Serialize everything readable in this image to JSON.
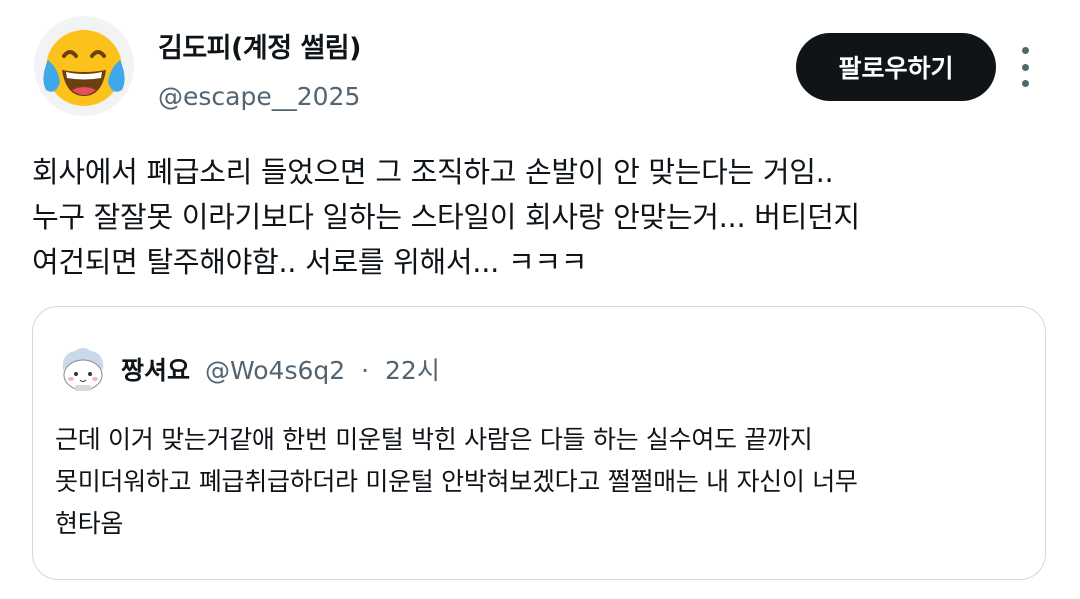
{
  "author": {
    "display_name": "김도피(계정 썰림)",
    "handle": "@escape__2025",
    "avatar_icon": "face-with-tears-of-joy-emoji"
  },
  "actions": {
    "follow_label": "팔로우하기",
    "more_icon": "more-vertical-icon"
  },
  "tweet": {
    "lines": [
      "회사에서 폐급소리 들었으면 그 조직하고 손발이 안 맞는다는 거임..",
      "누구 잘잘못 이라기보다 일하는 스타일이 회사랑 안맞는거... 버티던지",
      "여건되면 탈주해야함.. 서로를 위해서... ㅋㅋㅋ"
    ]
  },
  "quote": {
    "display_name": "짱셔요",
    "handle": "@Wo4s6q2",
    "separator": "·",
    "time": "22시",
    "avatar_icon": "cartoon-character-avatar",
    "lines": [
      "근데 이거 맞는거같애 한번 미운털 박힌 사람은 다들 하는 실수여도 끝까지",
      "못미더워하고 폐급취급하더라 미운털 안박혀보겠다고 쩔쩔매는 내 자신이 너무",
      "현타옴"
    ]
  },
  "colors": {
    "text": "#0f1419",
    "secondary": "#536471",
    "border": "#cfd9de",
    "button_bg": "#0f1419",
    "emoji_yellow": "#fcc21b",
    "tear_blue": "#3ea8ea"
  }
}
